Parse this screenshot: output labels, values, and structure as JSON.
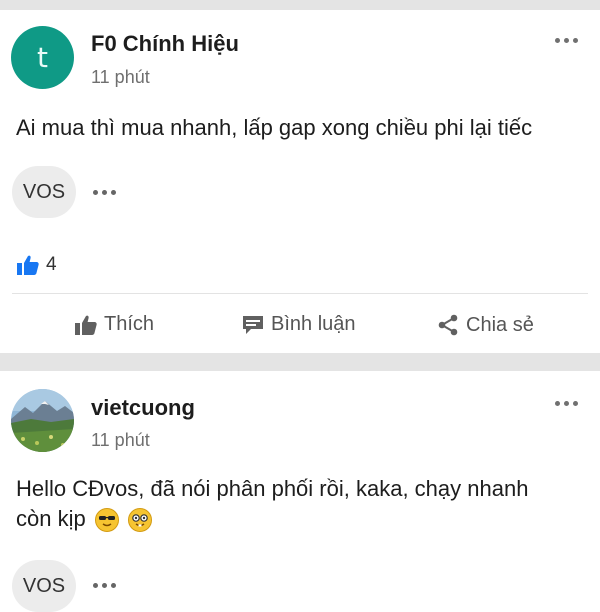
{
  "post1": {
    "avatar_letter": "t",
    "author": "F0 Chính Hiệu",
    "time": "11 phút",
    "text": "Ai mua thì mua nhanh, lấp gap xong chiều phi lại tiếc",
    "tag": "VOS",
    "like_count": "4",
    "actions": {
      "like": "Thích",
      "comment": "Bình luận",
      "share": "Chia sẻ"
    }
  },
  "post2": {
    "author": "vietcuong",
    "time": "11 phút",
    "text_line1": "Hello CĐvos, đã nói phân phối rồi, kaka, chạy nhanh",
    "text_line2": "còn kịp",
    "emojis": [
      "sunglasses-face",
      "nerd-face"
    ],
    "tag": "VOS"
  },
  "colors": {
    "avatar_bg": "#0f9a86",
    "like_blue": "#1877f2",
    "separator": "#e4e4e4"
  }
}
